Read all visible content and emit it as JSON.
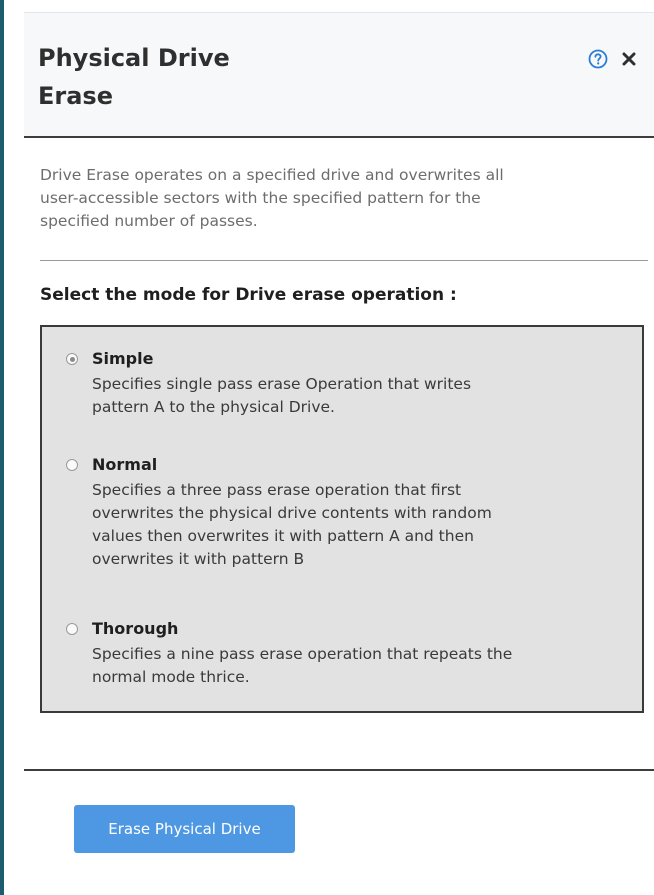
{
  "dialog": {
    "title_line1": "Physical Drive",
    "title_line2": "Erase",
    "help_icon": "question-circle-icon",
    "close_icon": "close-x-icon",
    "description_lines": [
      "Drive Erase operates on a specified drive and overwrites all",
      "user-accessible sectors with the specified pattern for the",
      "specified number of passes."
    ],
    "mode_heading": "Select the mode for Drive erase operation :",
    "modes": [
      {
        "label": "Simple",
        "selected": true,
        "description_lines": [
          "Specifies single pass erase Operation that writes",
          "pattern A to the physical Drive."
        ]
      },
      {
        "label": "Normal",
        "selected": false,
        "description_lines": [
          "Specifies a three pass erase operation that first",
          "overwrites the physical drive contents with random",
          "values then overwrites it with pattern A and then",
          "overwrites it with pattern B"
        ]
      },
      {
        "label": "Thorough",
        "selected": false,
        "description_lines": [
          "Specifies a nine pass erase operation that repeats the",
          "normal mode thrice."
        ]
      }
    ],
    "submit_label": "Erase Physical Drive",
    "colors": {
      "accent_button": "#4e97e3",
      "help_icon": "#2b7cd3",
      "left_rail": "#1d5c6e"
    }
  }
}
